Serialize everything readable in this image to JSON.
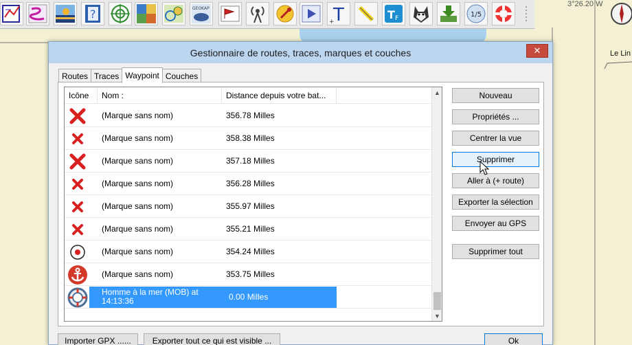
{
  "map": {
    "coordinate_text": "3°26.20 W",
    "place_label": "Le Lin"
  },
  "toolbar": {
    "buttons": [
      {
        "icon": "routes-icon"
      },
      {
        "icon": "draw-route-icon"
      },
      {
        "icon": "landscape-icon"
      },
      {
        "icon": "help-book-icon"
      },
      {
        "icon": "target-icon"
      },
      {
        "icon": "chart-mosaic-icon"
      },
      {
        "icon": "map-view-icon"
      },
      {
        "icon": "geokap-icon",
        "caption": "GEOKAP"
      },
      {
        "icon": "mark-flag-icon"
      },
      {
        "icon": "antenna-icon"
      },
      {
        "icon": "tools-icon"
      },
      {
        "icon": "play-icon"
      },
      {
        "icon": "text-tool-icon"
      },
      {
        "icon": "highlighter-icon"
      },
      {
        "icon": "tide-font-icon"
      },
      {
        "icon": "husky-dog-icon"
      },
      {
        "icon": "download-icon"
      },
      {
        "icon": "zoom-scale-icon",
        "caption": "1/5"
      },
      {
        "icon": "lifebuoy-icon"
      }
    ]
  },
  "dialog": {
    "title": "Gestionnaire de routes, traces, marques et couches",
    "close_label": "✕",
    "tabs": [
      {
        "label": "Routes",
        "active": false
      },
      {
        "label": "Traces",
        "active": false
      },
      {
        "label": "Waypoint",
        "active": true
      },
      {
        "label": "Couches",
        "active": false
      }
    ],
    "columns": [
      "Icône",
      "Nom :",
      "Distance depuis votre bat..."
    ],
    "rows": [
      {
        "icon": "red-x-large",
        "name": "(Marque sans nom)",
        "distance": "356.78 Milles"
      },
      {
        "icon": "red-x-small",
        "name": "(Marque sans nom)",
        "distance": "358.38 Milles"
      },
      {
        "icon": "red-x-large",
        "name": "(Marque sans nom)",
        "distance": "357.18 Milles"
      },
      {
        "icon": "red-x-small",
        "name": "(Marque sans nom)",
        "distance": "356.28 Milles"
      },
      {
        "icon": "red-x-small",
        "name": "(Marque sans nom)",
        "distance": "355.97 Milles"
      },
      {
        "icon": "red-x-small",
        "name": "(Marque sans nom)",
        "distance": "355.21 Milles"
      },
      {
        "icon": "circle-dot",
        "name": "(Marque sans nom)",
        "distance": "354.24 Milles"
      },
      {
        "icon": "anchor",
        "name": "(Marque sans nom)",
        "distance": "353.75 Milles"
      },
      {
        "icon": "lifebuoy",
        "name": "Homme à la mer (MOB) at 14:13:36",
        "distance": "0.00 Milles",
        "selected": true
      }
    ],
    "buttons": {
      "new": "Nouveau",
      "properties": "Propriétés ...",
      "center": "Centrer la vue",
      "delete": "Supprimer",
      "goto": "Aller à (+ route)",
      "export_selection": "Exporter la sélection",
      "send_gps": "Envoyer au GPS",
      "delete_all": "Supprimer tout"
    },
    "bottom": {
      "import_gpx": "Importer GPX ......",
      "export_visible": "Exporter tout ce qui est visible ...",
      "ok": "Ok"
    }
  },
  "colors": {
    "selection": "#3399ff",
    "mark_red": "#d92020",
    "titlebar": "#bcd6f0",
    "close_red": "#c74b3c",
    "sea_blue": "#a9d1ee"
  }
}
